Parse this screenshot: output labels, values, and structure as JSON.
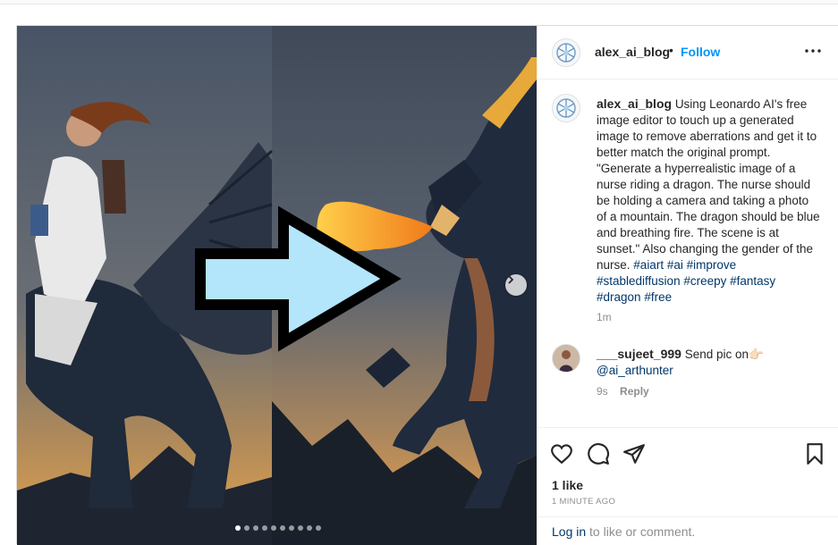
{
  "post": {
    "author": "alex_ai_blog",
    "bullet": "•",
    "follow_label": "Follow",
    "caption": "Using Leonardo AI's free image editor to touch up a generated image to remove aberrations and get it to better match the original prompt. \"Generate a hyperrealistic image of a nurse riding a dragon. The nurse should be holding a camera and taking a photo of a mountain. The dragon should be blue and breathing fire. The scene is at sunset.\" Also changing the gender of the nurse.",
    "hashtags": [
      "#aiart",
      "#ai",
      "#improve",
      "#stablediffusion",
      "#creepy",
      "#fantasy",
      "#dragon",
      "#free"
    ],
    "caption_time": "1m",
    "carousel": {
      "total": 10,
      "active_index": 0
    },
    "likes": "1 like",
    "posted_ago": "1 MINUTE AGO"
  },
  "comment": {
    "author": "___sujeet_999",
    "text": "Send pic on",
    "emoji": "👉🏻",
    "mention": "@ai_arthunter",
    "time": "9s",
    "reply_label": "Reply"
  },
  "footer": {
    "login_label": "Log in",
    "rest": "to like or comment."
  },
  "colors": {
    "accent": "#0095f6",
    "link": "#00376b",
    "muted": "#8e8e8e"
  },
  "icons": [
    "more-options-icon",
    "chevron-right-icon",
    "heart-icon",
    "comment-icon",
    "share-icon",
    "bookmark-icon"
  ]
}
